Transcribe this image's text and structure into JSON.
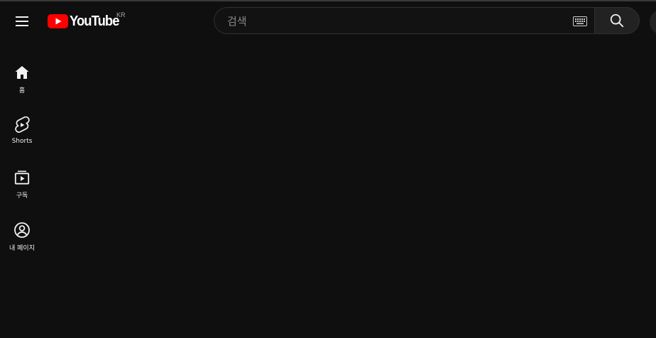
{
  "masthead": {
    "logo_text": "YouTube",
    "country_code": "KR",
    "search": {
      "placeholder": "검색",
      "value": ""
    }
  },
  "guide": {
    "items": [
      {
        "label": "홈",
        "icon": "home-icon"
      },
      {
        "label": "Shorts",
        "icon": "shorts-icon"
      },
      {
        "label": "구독",
        "icon": "subscriptions-icon"
      },
      {
        "label": "내 페이지",
        "icon": "my-page-icon"
      }
    ]
  },
  "colors": {
    "background": "#0f0f0f",
    "brand_red": "#ff0000",
    "text": "#f1f1f1",
    "search_border": "#303030",
    "search_button_bg": "#222222"
  }
}
